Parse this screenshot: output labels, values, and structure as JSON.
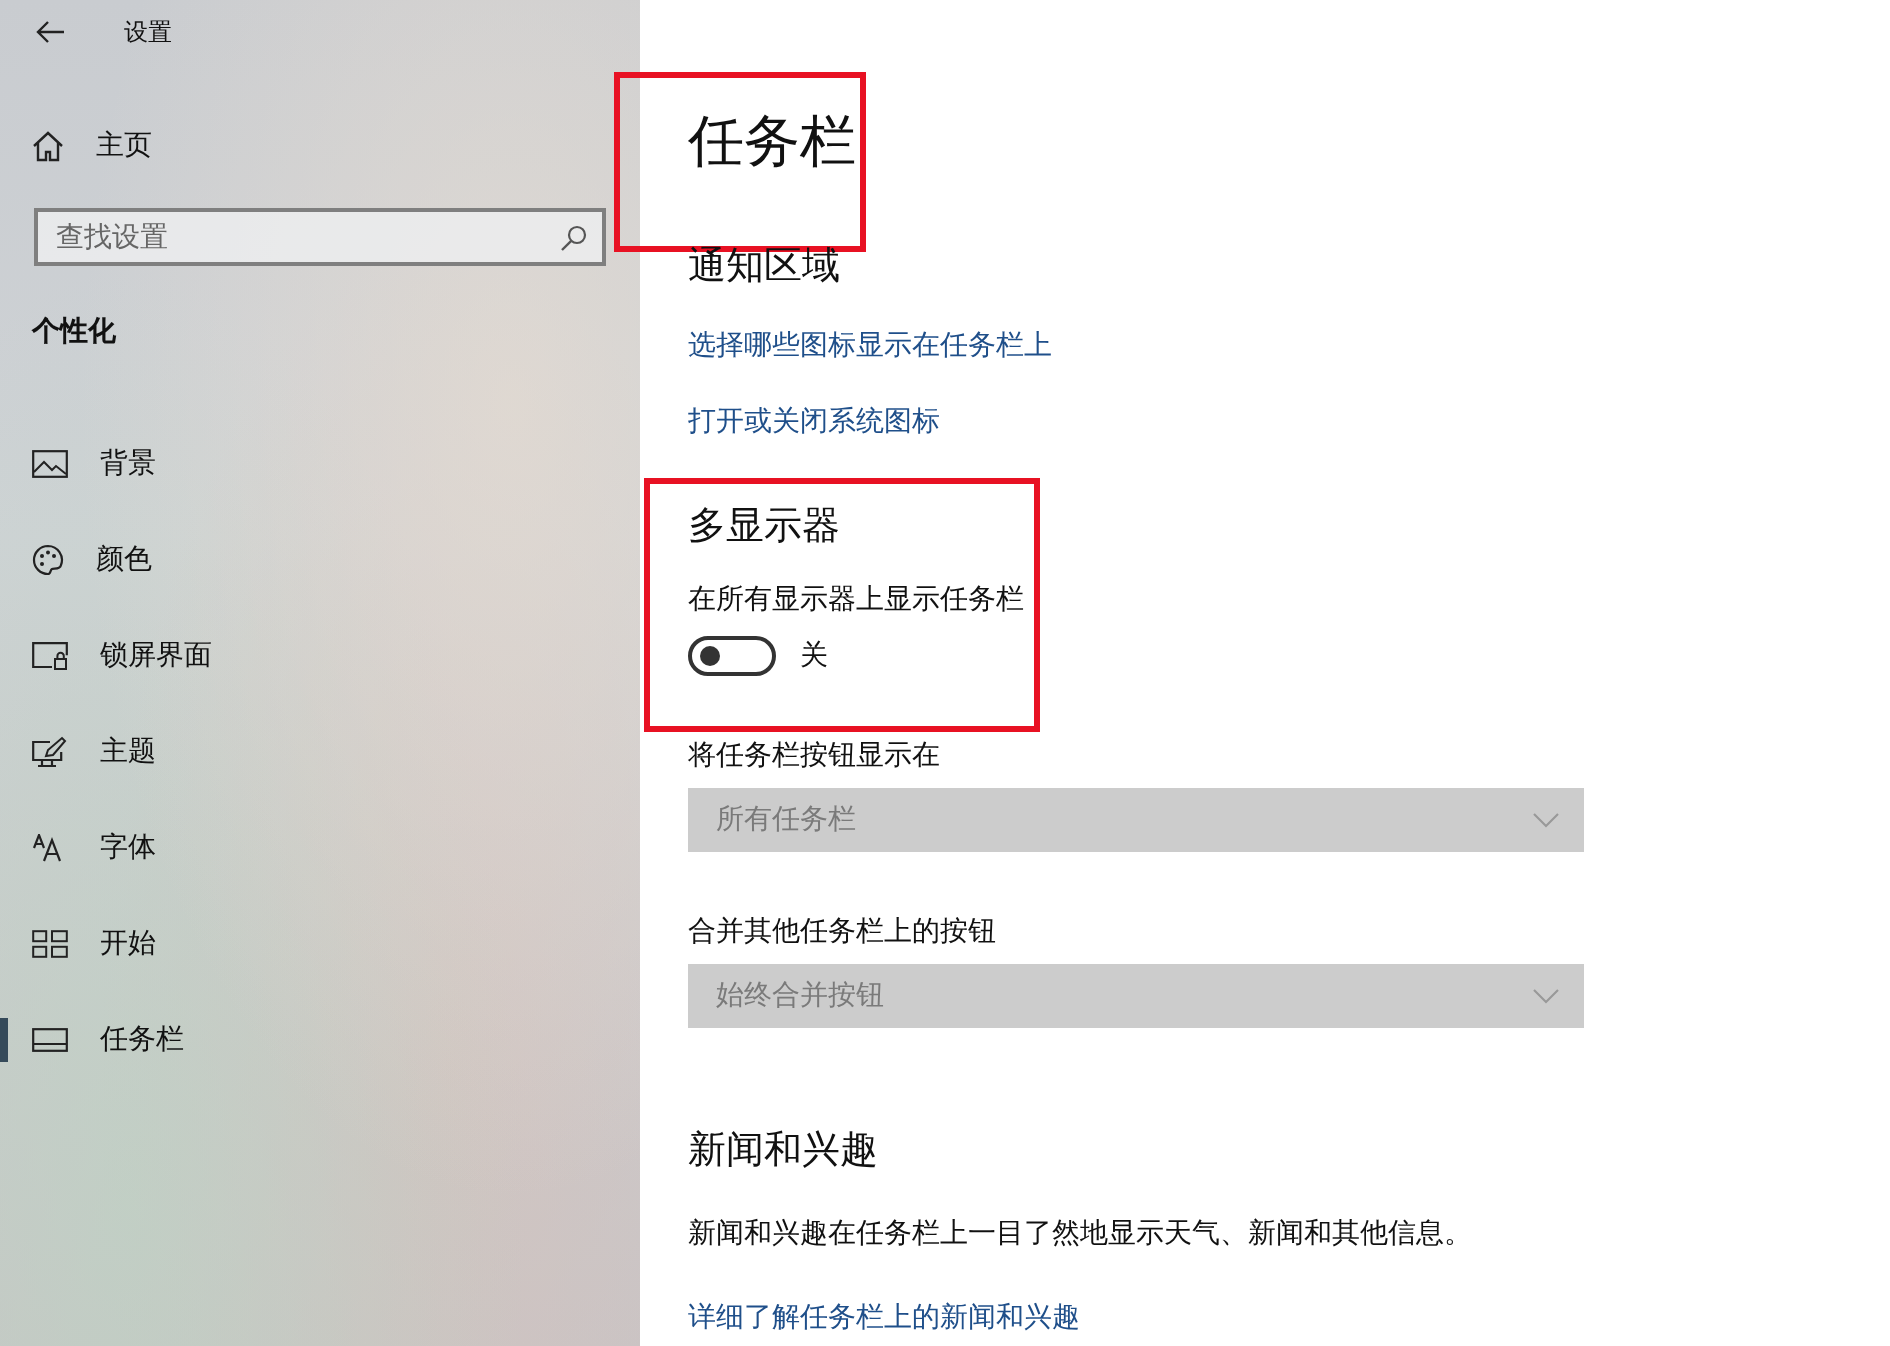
{
  "sidebar": {
    "title": "设置",
    "home": "主页",
    "search": {
      "placeholder": "查找设置"
    },
    "section": "个性化",
    "items": [
      {
        "label": "背景",
        "selected": false
      },
      {
        "label": "颜色",
        "selected": false
      },
      {
        "label": "锁屏界面",
        "selected": false
      },
      {
        "label": "主题",
        "selected": false
      },
      {
        "label": "字体",
        "selected": false
      },
      {
        "label": "开始",
        "selected": false
      },
      {
        "label": "任务栏",
        "selected": true
      }
    ]
  },
  "page": {
    "title": "任务栏",
    "title_highlighted": true,
    "sections": [
      {
        "heading": "通知区域",
        "highlighted": false,
        "items": [
          {
            "kind": "link",
            "text": "选择哪些图标显示在任务栏上"
          },
          {
            "kind": "link",
            "text": "打开或关闭系统图标"
          }
        ]
      },
      {
        "heading": "多显示器",
        "highlighted": true,
        "items": [
          {
            "kind": "toggle",
            "label": "在所有显示器上显示任务栏",
            "on": false,
            "state_text": "关"
          }
        ]
      },
      {
        "highlighted": false,
        "items": [
          {
            "kind": "dropdown",
            "label": "将任务栏按钮显示在",
            "value": "所有任务栏",
            "disabled": true
          },
          {
            "kind": "dropdown",
            "label": "合并其他任务栏上的按钮",
            "value": "始终合并按钮",
            "disabled": true
          }
        ]
      },
      {
        "heading": "新闻和兴趣",
        "highlighted": false,
        "items": [
          {
            "kind": "paragraph",
            "text": "新闻和兴趣在任务栏上一目了然地显示天气、新闻和其他信息。"
          },
          {
            "kind": "link",
            "text": "详细了解任务栏上的新闻和兴趣"
          }
        ]
      }
    ]
  }
}
